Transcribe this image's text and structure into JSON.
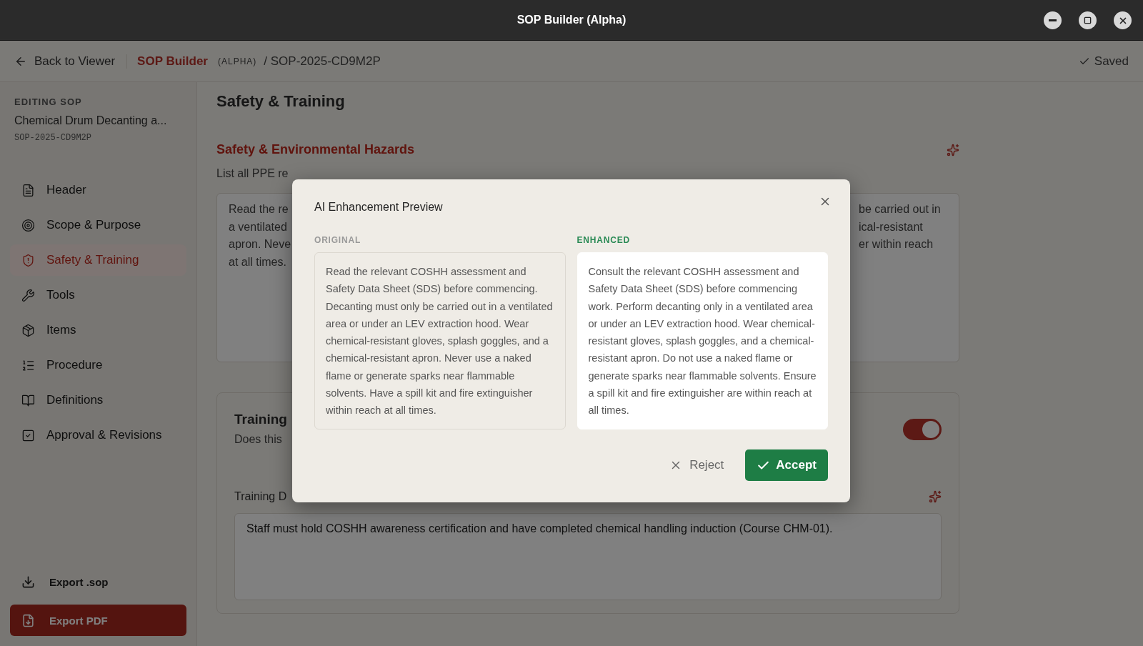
{
  "window": {
    "title": "SOP Builder (Alpha)"
  },
  "topbar": {
    "back_link": "Back to Viewer",
    "brand": "SOP Builder",
    "badge": "(ALPHA)",
    "path": "/ SOP-2025-CD9M2P",
    "status": "Saved"
  },
  "sidebar": {
    "eyebrow": "EDITING SOP",
    "sop_title": "Chemical Drum Decanting a...",
    "sop_id": "SOP-2025-CD9M2P",
    "items": [
      {
        "label": "Header",
        "kind": "file",
        "selected": false
      },
      {
        "label": "Scope & Purpose",
        "kind": "target",
        "selected": false
      },
      {
        "label": "Safety & Training",
        "kind": "shield",
        "selected": true
      },
      {
        "label": "Tools",
        "kind": "wrench",
        "selected": false
      },
      {
        "label": "Items",
        "kind": "package",
        "selected": false
      },
      {
        "label": "Procedure",
        "kind": "list",
        "selected": false
      },
      {
        "label": "Definitions",
        "kind": "book",
        "selected": false
      },
      {
        "label": "Approval & Revisions",
        "kind": "check",
        "selected": false
      }
    ],
    "export_sop": "Export .sop",
    "export_pdf": "Export PDF"
  },
  "main": {
    "heading": "Safety & Training",
    "hazards": {
      "title": "Safety & Environmental Hazards",
      "hint": "List all PPE re",
      "text_lines": [
        {
          "left": "Read the re",
          "right": "be carried out in"
        },
        {
          "left": "a ventilated",
          "right": "ical-resistant"
        },
        {
          "left": "apron. Neve",
          "right": "er within reach"
        },
        {
          "left": "at all times."
        }
      ]
    },
    "training": {
      "title": "Training",
      "hint": "Does this",
      "enabled": true,
      "details_label": "Training D",
      "details_value": "Staff must hold COSHH awareness certification and have completed chemical handling induction (Course CHM-01)."
    }
  },
  "modal": {
    "title": "AI Enhancement Preview",
    "original_label": "ORIGINAL",
    "original_text": "Read the relevant COSHH assessment and Safety Data Sheet (SDS) before commencing. Decanting must only be carried out in a ventilated area or under an LEV extraction hood. Wear chemical-resistant gloves, splash goggles, and a chemical-resistant apron. Never use a naked flame or generate sparks near flammable solvents. Have a spill kit and fire extinguisher within reach at all times.",
    "enhanced_label": "ENHANCED",
    "enhanced_text": "Consult the relevant COSHH assessment and Safety Data Sheet (SDS) before commencing work. Perform decanting only in a ventilated area or under an LEV extraction hood. Wear chemical-resistant gloves, splash goggles, and a chemical-resistant apron. Do not use a naked flame or generate sparks near flammable solvents. Ensure a spill kit and fire extinguisher are within reach at all times.",
    "reject": "Reject",
    "accept": "Accept"
  }
}
